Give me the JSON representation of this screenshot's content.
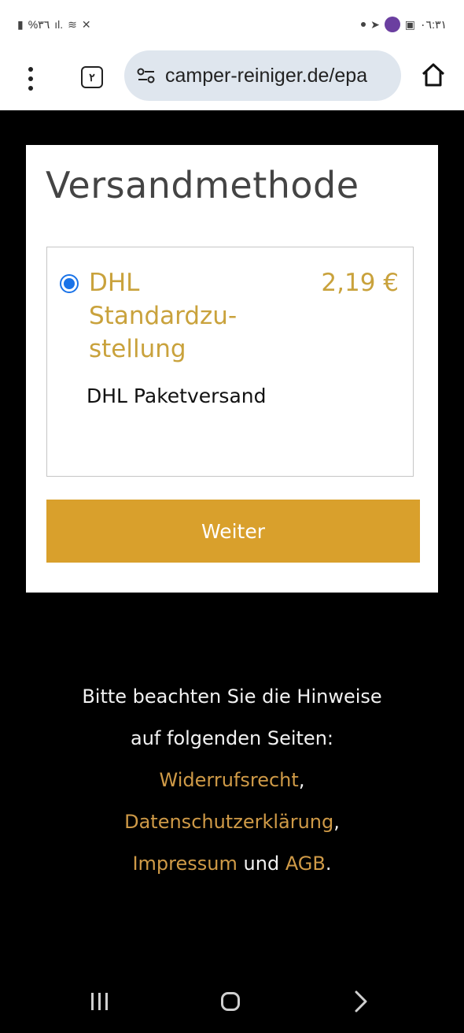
{
  "status_bar": {
    "left_text": "%٣٦",
    "time": "٠٦:٣١"
  },
  "browser": {
    "tab_count": "٢",
    "url": "camper-reiniger.de/epa"
  },
  "shipping": {
    "title": "Versandmethode",
    "option_name": "DHL Standardzu-stellung",
    "option_price": "2,19 €",
    "option_description": "DHL Paketversand",
    "selected": true,
    "continue_label": "Weiter"
  },
  "notice": {
    "line1": "Bitte beachten Sie die Hinweise",
    "line2": "auf folgenden Seiten:",
    "link_withdrawal": "Widerrufsrecht",
    "link_privacy": "Datenschutzerklärung",
    "link_imprint": "Impressum",
    "and_word": "und",
    "link_terms": "AGB",
    "comma": ",",
    "period": "."
  },
  "colors": {
    "accent_gold": "#d9a02c",
    "link_gold": "#cf9a47",
    "radio_blue": "#1a73e8"
  }
}
